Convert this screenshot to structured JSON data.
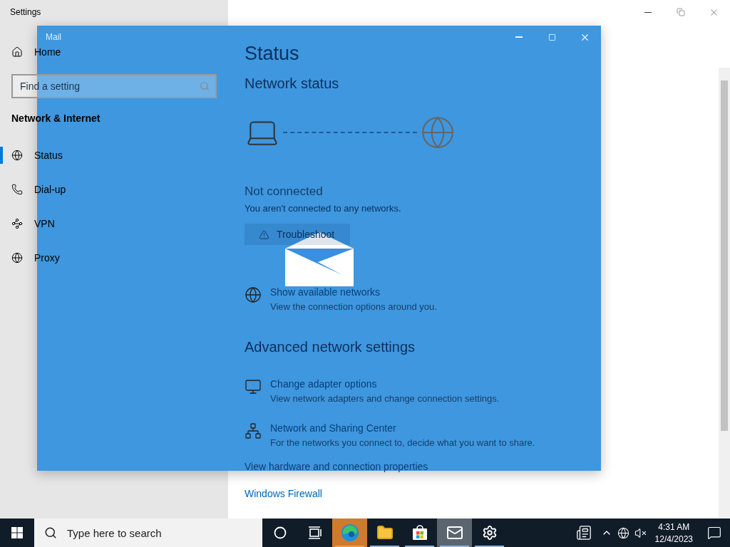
{
  "settings_window": {
    "title": "Settings"
  },
  "sidebar": {
    "home": "Home",
    "search": {
      "placeholder": "Find a setting"
    },
    "section": "Network & Internet",
    "items": [
      {
        "kind": "status",
        "label": "Status",
        "selected": true
      },
      {
        "kind": "dialup",
        "label": "Dial-up",
        "selected": false
      },
      {
        "kind": "vpn",
        "label": "VPN",
        "selected": false
      },
      {
        "kind": "proxy",
        "label": "Proxy",
        "selected": false
      }
    ]
  },
  "content": {
    "title": "Status",
    "network_heading": "Network status",
    "connected": false,
    "status_title": "Not connected",
    "status_text": "You aren't connected to any networks.",
    "troubleshoot_button": "Troubleshoot",
    "show_networks": {
      "kind": "globe",
      "title": "Show available networks",
      "description": "View the connection options around you."
    },
    "advanced_heading": "Advanced network settings",
    "advanced_items": [
      {
        "kind": "adapter",
        "title": "Change adapter options",
        "description": "View network adapters and change connection settings."
      },
      {
        "kind": "sharing",
        "title": "Network and Sharing Center",
        "description": "For the networks you connect to, decide what you want to share."
      }
    ],
    "links": [
      "View hardware and connection properties",
      "Windows Firewall"
    ]
  },
  "mail_splash": {
    "title": "Mail"
  },
  "taskbar": {
    "search": {
      "placeholder": "Type here to search"
    },
    "apps": [
      {
        "kind": "cortana",
        "running": false,
        "selected": false,
        "flashing": false
      },
      {
        "kind": "taskview",
        "running": false,
        "selected": false,
        "flashing": false
      },
      {
        "kind": "edge",
        "running": true,
        "selected": false,
        "flashing": true
      },
      {
        "kind": "explorer",
        "running": true,
        "selected": false,
        "flashing": false
      },
      {
        "kind": "store",
        "running": true,
        "selected": false,
        "flashing": false
      },
      {
        "kind": "mail",
        "running": true,
        "selected": true,
        "flashing": false
      },
      {
        "kind": "settings",
        "running": true,
        "selected": false,
        "flashing": false
      }
    ],
    "clock": {
      "time": "4:31 AM",
      "date": "12/4/2023"
    }
  }
}
